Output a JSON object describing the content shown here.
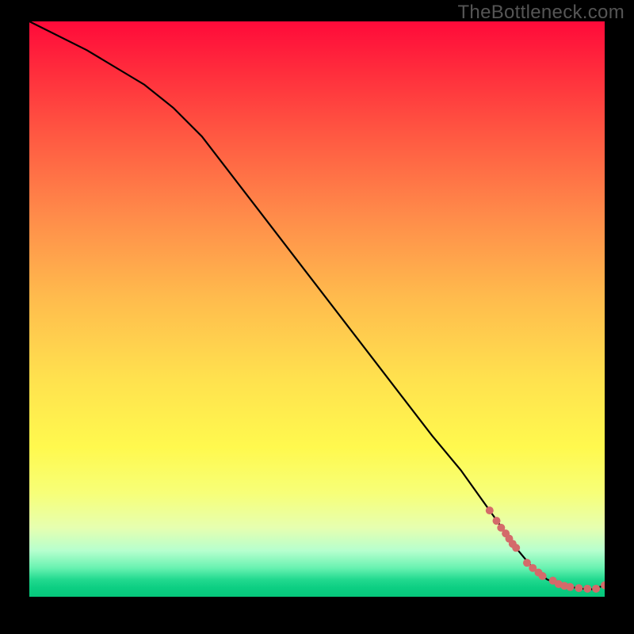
{
  "watermark": {
    "text": "TheBottleneck.com"
  },
  "chart_data": {
    "type": "line",
    "title": "",
    "xlabel": "",
    "ylabel": "",
    "xlim": [
      0,
      100
    ],
    "ylim": [
      0,
      100
    ],
    "grid": false,
    "legend": false,
    "series": [
      {
        "name": "curve",
        "color": "#000000",
        "x": [
          0,
          10,
          20,
          25,
          30,
          40,
          50,
          60,
          70,
          75,
          80,
          85,
          87.5,
          90,
          92,
          94,
          96,
          98,
          100
        ],
        "y": [
          100,
          95,
          89,
          85,
          80,
          67,
          54,
          41,
          28,
          22,
          15,
          8,
          5,
          3,
          2.2,
          1.7,
          1.4,
          1.3,
          2
        ]
      }
    ],
    "points": {
      "name": "markers",
      "color": "#d46a6a",
      "x": [
        80.0,
        81.2,
        82.0,
        82.8,
        83.4,
        84.0,
        84.6,
        86.5,
        87.5,
        88.5,
        89.2,
        91.0,
        92.0,
        93.0,
        94.0,
        95.5,
        97.0,
        98.5,
        100.0
      ],
      "y": [
        15.0,
        13.2,
        12.0,
        11.0,
        10.1,
        9.2,
        8.5,
        5.9,
        5.0,
        4.2,
        3.6,
        2.8,
        2.2,
        1.9,
        1.7,
        1.5,
        1.4,
        1.4,
        2.0
      ]
    }
  }
}
